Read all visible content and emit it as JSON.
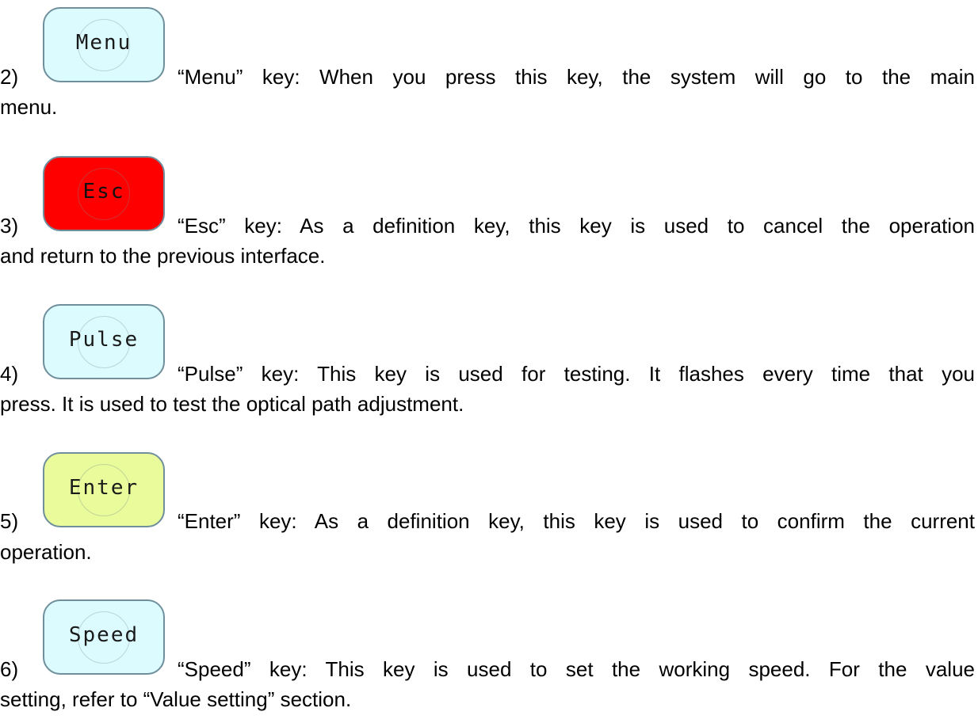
{
  "items": [
    {
      "number": "2)",
      "key_label": "Menu",
      "key_color": "#dcfbff",
      "key_text_color": "#1a1a1a",
      "line1": "“Menu” key: When you press this key, the system will go to the main",
      "line2": "menu."
    },
    {
      "number": "3)",
      "key_label": "Esc",
      "key_color": "#ff0000",
      "key_text_color": "#111111",
      "line1": "“Esc” key: As a definition key, this key is used to cancel the operation",
      "line2": "and return to the previous interface."
    },
    {
      "number": "4)",
      "key_label": "Pulse",
      "key_color": "#dcfbff",
      "key_text_color": "#1a1a1a",
      "line1": "“Pulse” key: This key is used for testing. It flashes every time that you",
      "line2": "press. It is used to test the optical path adjustment."
    },
    {
      "number": "5)",
      "key_label": "Enter",
      "key_color": "#e9fb9a",
      "key_text_color": "#1a1a1a",
      "line1": "“Enter” key: As a definition key, this key is used to confirm the current",
      "line2": "operation."
    },
    {
      "number": "6)",
      "key_label": "Speed",
      "key_color": "#dcfbff",
      "key_text_color": "#1a1a1a",
      "line1": "“Speed” key: This key is used to set the working speed. For the value",
      "line2": "setting, refer to “Value setting” section."
    }
  ]
}
